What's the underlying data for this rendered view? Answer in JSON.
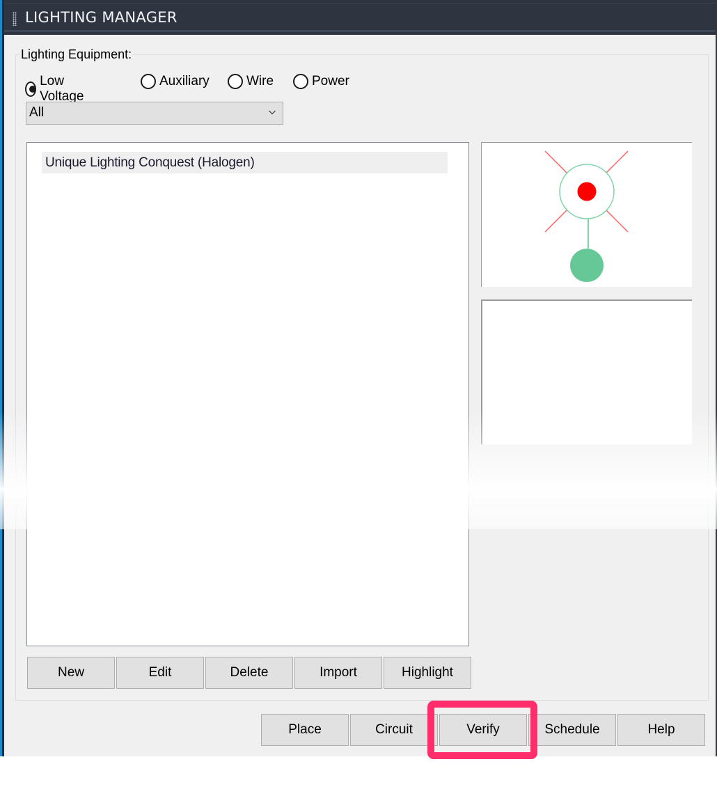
{
  "window": {
    "title": "LIGHTING MANAGER"
  },
  "equipment_group": {
    "label": "Lighting Equipment:",
    "radios": [
      {
        "label": "Low Voltage",
        "checked": true
      },
      {
        "label": "Auxiliary",
        "checked": false
      },
      {
        "label": "Wire",
        "checked": false
      },
      {
        "label": "Power",
        "checked": false
      }
    ],
    "filter": {
      "selected": "All"
    },
    "list": {
      "items": [
        {
          "label": "Unique Lighting Conquest (Halogen)",
          "selected": true
        }
      ]
    },
    "preview": {
      "symbol": "light-fixture-symbol",
      "colors": {
        "ring": "#7fd4a8",
        "center": "#ff0000",
        "rays": "#ff6060",
        "base": "#66c896"
      }
    },
    "buttons": {
      "new": "New",
      "edit": "Edit",
      "delete": "Delete",
      "import": "Import",
      "highlight": "Highlight"
    }
  },
  "footer_buttons": {
    "place": "Place",
    "circuit": "Circuit",
    "verify": "Verify",
    "schedule": "Schedule",
    "help": "Help"
  },
  "annotation": {
    "highlighted_button": "Verify",
    "color": "#ff2d6b"
  }
}
